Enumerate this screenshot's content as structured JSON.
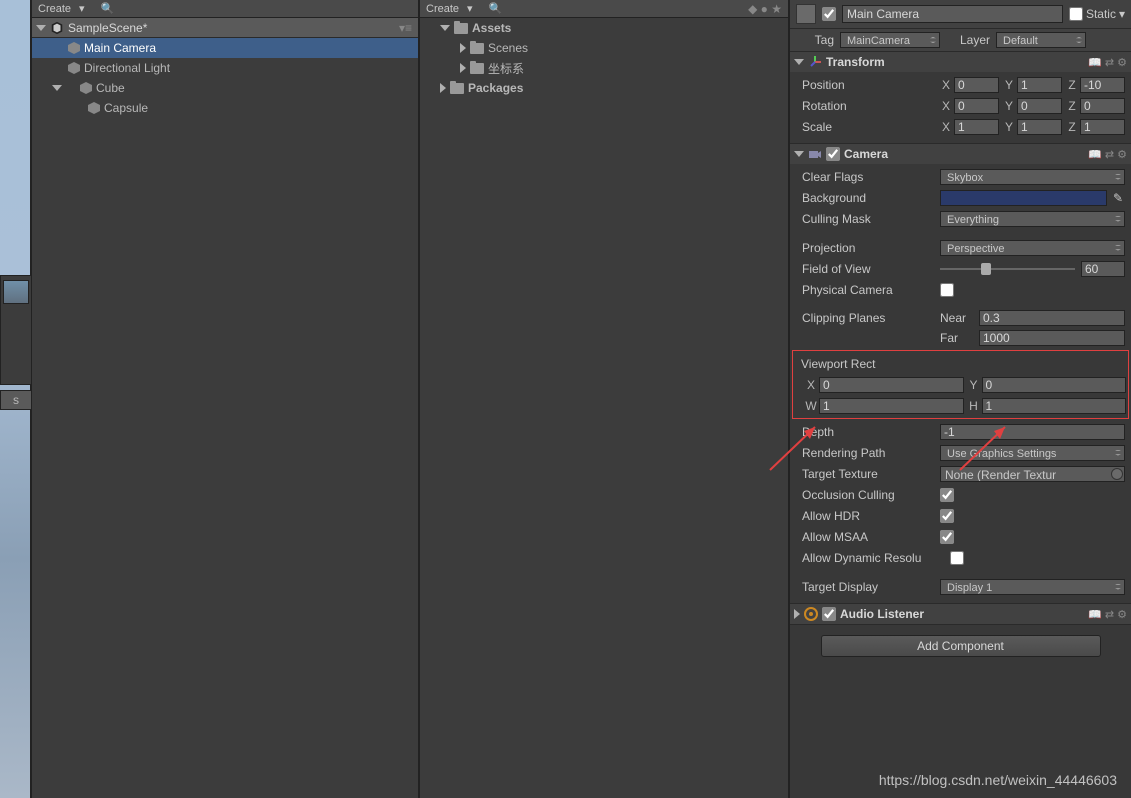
{
  "hierarchy": {
    "createLabel": "Create",
    "sceneName": "SampleScene*",
    "items": [
      {
        "label": "Main Camera",
        "selected": true
      },
      {
        "label": "Directional Light",
        "selected": false
      },
      {
        "label": "Cube",
        "selected": false,
        "foldout": true
      },
      {
        "label": "Capsule",
        "selected": false,
        "child": true
      }
    ]
  },
  "project": {
    "createLabel": "Create",
    "rootA": "Assets",
    "rootA_children": [
      "Scenes",
      "坐标系"
    ],
    "rootB": "Packages"
  },
  "inspector": {
    "goName": "Main Camera",
    "staticLabel": "Static",
    "tagLabel": "Tag",
    "tagValue": "MainCamera",
    "layerLabel": "Layer",
    "layerValue": "Default",
    "transform": {
      "title": "Transform",
      "posLabel": "Position",
      "posX": "0",
      "posY": "1",
      "posZ": "-10",
      "rotLabel": "Rotation",
      "rotX": "0",
      "rotY": "0",
      "rotZ": "0",
      "sclLabel": "Scale",
      "sclX": "1",
      "sclY": "1",
      "sclZ": "1"
    },
    "camera": {
      "title": "Camera",
      "clearFlagsLabel": "Clear Flags",
      "clearFlagsValue": "Skybox",
      "backgroundLabel": "Background",
      "cullingMaskLabel": "Culling Mask",
      "cullingMaskValue": "Everything",
      "projectionLabel": "Projection",
      "projectionValue": "Perspective",
      "fovLabel": "Field of View",
      "fovValue": "60",
      "physCamLabel": "Physical Camera",
      "clipLabel": "Clipping Planes",
      "clipNearLabel": "Near",
      "clipNearValue": "0.3",
      "clipFarLabel": "Far",
      "clipFarValue": "1000",
      "viewportLabel": "Viewport Rect",
      "vpX": "0",
      "vpY": "0",
      "vpW": "1",
      "vpH": "1",
      "depthLabel": "Depth",
      "depthValue": "-1",
      "renderPathLabel": "Rendering Path",
      "renderPathValue": "Use Graphics Settings",
      "targetTexLabel": "Target Texture",
      "targetTexValue": "None (Render Textur",
      "occLabel": "Occlusion Culling",
      "hdrLabel": "Allow HDR",
      "msaaLabel": "Allow MSAA",
      "dynResLabel": "Allow Dynamic Resolu",
      "targetDispLabel": "Target Display",
      "targetDispValue": "Display 1"
    },
    "audioListener": {
      "title": "Audio Listener"
    },
    "addComponentLabel": "Add Component"
  },
  "watermark": "https://blog.csdn.net/weixin_44446603"
}
